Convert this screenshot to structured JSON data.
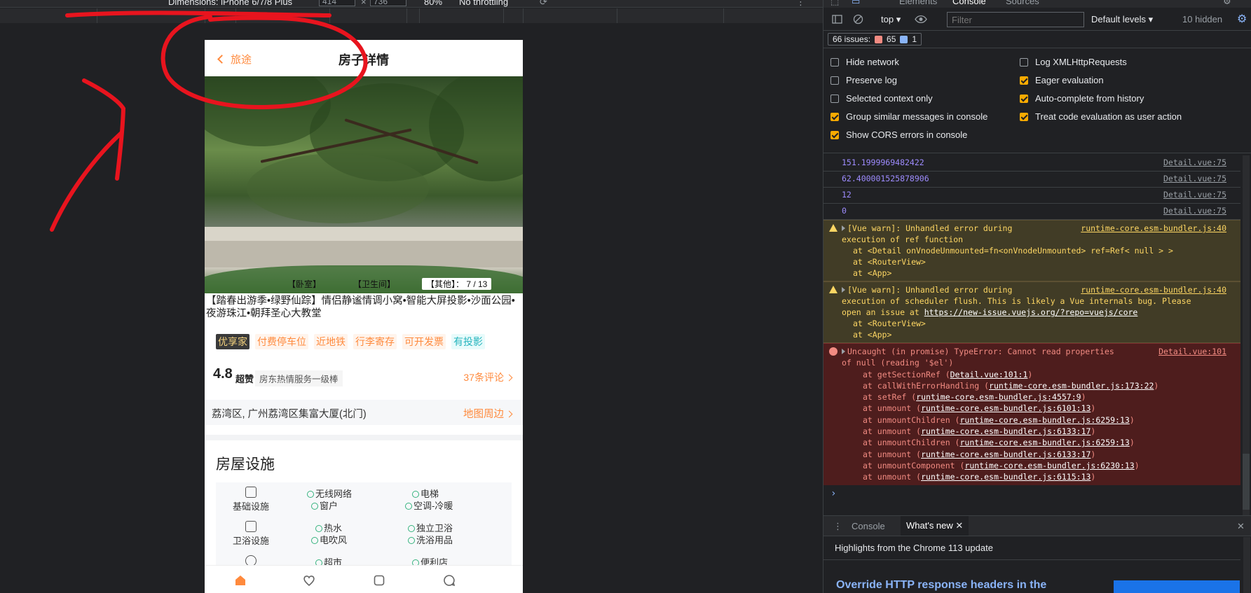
{
  "device_toolbar": {
    "dimensions_label": "Dimensions: iPhone 6/7/8 Plus",
    "width_value": "414",
    "height_value": "736",
    "zoom": "80%",
    "throttling": "No throttling"
  },
  "phone": {
    "back_label": "旅途",
    "nav_title": "房子详情",
    "hero_tabs": [
      "【卧室】",
      "【卫生间】",
      "【其他】：  7 / 13"
    ],
    "house_title": "【踏春出游季•绿野仙踪】情侣静谧情调小窝•智能大屏投影•沙面公园•夜游珠江•朝拜圣心大教堂",
    "tags": [
      "优享家",
      "付费停车位",
      "近地铁",
      "行李寄存",
      "可开发票",
      "有投影"
    ],
    "rating": {
      "score": "4.8",
      "label": "超赞",
      "desc": "房东热情服务一级棒",
      "reviews": "37条评论"
    },
    "address": {
      "text": "荔湾区, 广州荔湾区集富大厦(北门)",
      "map_link": "地图周边"
    },
    "facilities": {
      "title": "房屋设施",
      "rows": [
        {
          "category": "基础设施",
          "items": [
            "无线网络",
            "电梯",
            "窗户",
            "空调-冷暖"
          ]
        },
        {
          "category": "卫浴设施",
          "items": [
            "热水",
            "独立卫浴",
            "电吹风",
            "洗浴用品"
          ]
        },
        {
          "category": "",
          "items": [
            "超市",
            "便利店",
            "",
            ""
          ]
        }
      ]
    },
    "tabbar_icons": [
      "home-icon",
      "heart-icon",
      "square-icon",
      "chat-icon"
    ]
  },
  "devtools": {
    "tabs": [
      "Elements",
      "Console",
      "Sources"
    ],
    "context": "top",
    "filter_placeholder": "Filter",
    "levels": "Default levels",
    "hidden": "10 hidden",
    "issues": {
      "label": "66 issues:",
      "errors": "65",
      "messages": "1"
    },
    "settings": [
      {
        "label": "Hide network",
        "checked": false
      },
      {
        "label": "Log XMLHttpRequests",
        "checked": false
      },
      {
        "label": "Preserve log",
        "checked": false
      },
      {
        "label": "Eager evaluation",
        "checked": true
      },
      {
        "label": "Selected context only",
        "checked": false
      },
      {
        "label": "Auto-complete from history",
        "checked": true
      },
      {
        "label": "Group similar messages in console",
        "checked": true
      },
      {
        "label": "Treat code evaluation as user action",
        "checked": true
      },
      {
        "label": "Show CORS errors in console",
        "checked": true
      }
    ],
    "logs": [
      {
        "value": "151.1999969482422",
        "source": "Detail.vue:75"
      },
      {
        "value": "62.400001525878906",
        "source": "Detail.vue:75"
      },
      {
        "value": "12",
        "source": "Detail.vue:75"
      },
      {
        "value": "0",
        "source": "Detail.vue:75"
      }
    ],
    "warn1": {
      "line1": "[Vue warn]: Unhandled error during",
      "line2": "execution of ref function",
      "source": "runtime-core.esm-bundler.js:40",
      "stack": [
        "at <Detail onVnodeUnmounted=fn<onVnodeUnmounted> ref=Ref< null > >",
        "at <RouterView>",
        "at <App>"
      ]
    },
    "warn2": {
      "line1": "[Vue warn]: Unhandled error during",
      "line2": "execution of scheduler flush. This is likely a Vue internals bug. Please",
      "line3_prefix": "open an issue at ",
      "line3_link": "https://new-issue.vuejs.org/?repo=vuejs/core",
      "source": "runtime-core.esm-bundler.js:40",
      "stack": [
        "at <RouterView>",
        "at <App>"
      ]
    },
    "error": {
      "line1": "Uncaught (in promise) TypeError: Cannot read properties",
      "line2": "of null (reading '$el')",
      "source": "Detail.vue:101",
      "stack": [
        {
          "fn": "at getSectionRef (",
          "loc": "Detail.vue:101:1"
        },
        {
          "fn": "at callWithErrorHandling (",
          "loc": "runtime-core.esm-bundler.js:173:22"
        },
        {
          "fn": "at setRef (",
          "loc": "runtime-core.esm-bundler.js:4557:9"
        },
        {
          "fn": "at unmount (",
          "loc": "runtime-core.esm-bundler.js:6101:13"
        },
        {
          "fn": "at unmountChildren (",
          "loc": "runtime-core.esm-bundler.js:6259:13"
        },
        {
          "fn": "at unmount (",
          "loc": "runtime-core.esm-bundler.js:6133:17"
        },
        {
          "fn": "at unmountChildren (",
          "loc": "runtime-core.esm-bundler.js:6259:13"
        },
        {
          "fn": "at unmount (",
          "loc": "runtime-core.esm-bundler.js:6133:17"
        },
        {
          "fn": "at unmountComponent (",
          "loc": "runtime-core.esm-bundler.js:6230:13"
        },
        {
          "fn": "at unmount (",
          "loc": "runtime-core.esm-bundler.js:6115:13"
        }
      ]
    },
    "prompt": "›",
    "drawer": {
      "console_tab": "Console",
      "whatsnew_tab": "What's new",
      "highlights": "Highlights from the Chrome 113 update",
      "override_title": "Override HTTP response headers in the"
    }
  },
  "colors": {
    "accent": "#ff8a3d",
    "annotation": "#e8141e",
    "error_bg": "#4e1d1d",
    "warn_bg": "#413c26"
  }
}
